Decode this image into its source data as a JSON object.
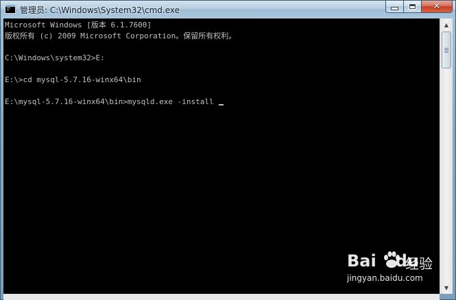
{
  "window": {
    "title": "管理员: C:\\Windows\\System32\\cmd.exe",
    "app_icon": "cmd-icon",
    "controls": {
      "minimize_icon": "minimize-icon",
      "maximize_icon": "maximize-icon",
      "close_icon": "close-icon",
      "close_glyph": "✕"
    }
  },
  "console": {
    "background": "#000000",
    "foreground": "#c0c0c0",
    "lines": [
      "Microsoft Windows [版本 6.1.7600]",
      "版权所有 (c) 2009 Microsoft Corporation。保留所有权利。",
      "",
      "C:\\Windows\\system32>E:",
      "",
      "E:\\>cd mysql-5.7.16-winx64\\bin",
      "",
      "E:\\mysql-5.7.16-winx64\\bin>mysqld.exe -install "
    ]
  },
  "scrollbar": {
    "up_arrow": "▲",
    "down_arrow": "▼"
  },
  "watermark": {
    "logo": "Bai",
    "logo_suffix": "du",
    "brand": "经验",
    "url": "jingyan.baidu.com"
  }
}
